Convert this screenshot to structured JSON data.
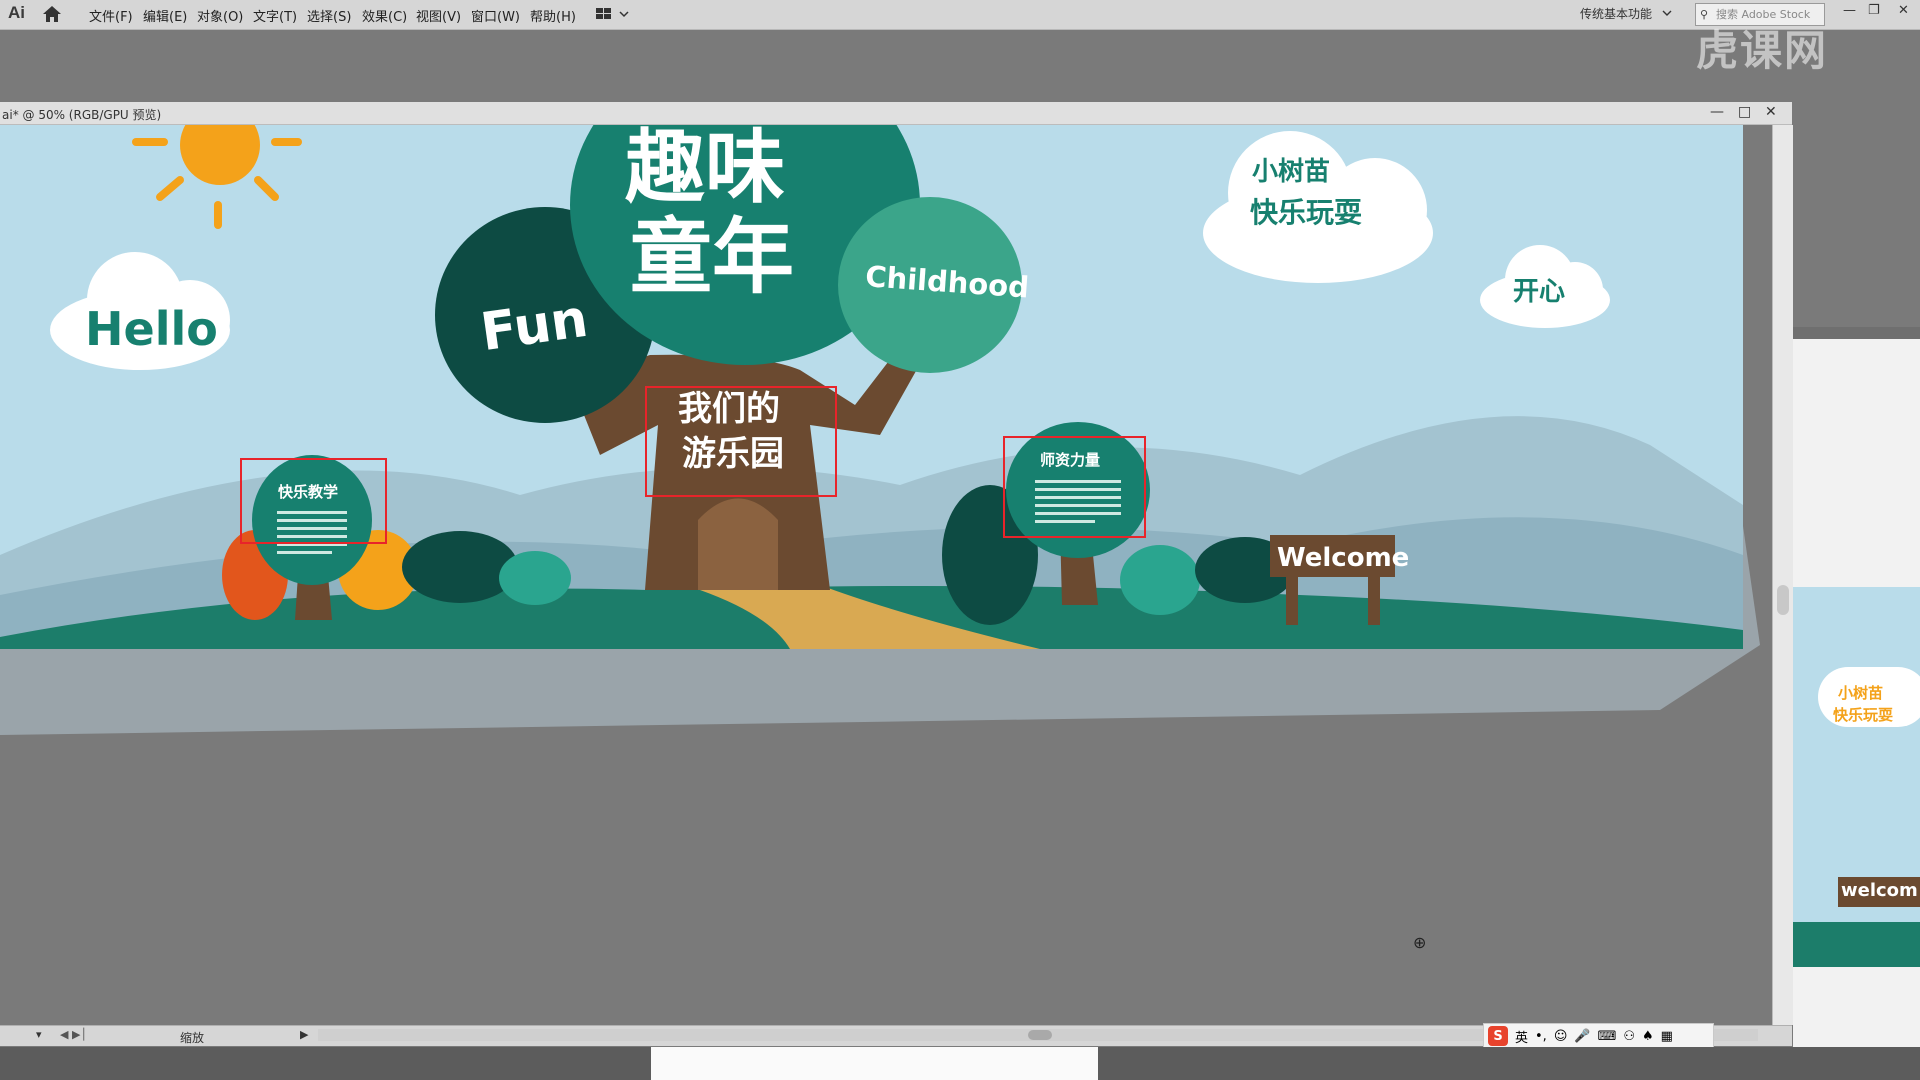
{
  "app": {
    "logo": "Ai",
    "menu": [
      "文件(F)",
      "编辑(E)",
      "对象(O)",
      "文字(T)",
      "选择(S)",
      "效果(C)",
      "视图(V)",
      "窗口(W)",
      "帮助(H)"
    ],
    "workspace": "传统基本功能",
    "search_placeholder": "搜索 Adobe Stock",
    "watermark": "虎课网"
  },
  "document": {
    "title": "ai* @ 50% (RGB/GPU 预览)",
    "status_zoom_label": "缩放"
  },
  "artwork": {
    "title_line1": "趣味",
    "title_line2": "童年",
    "tree_left_text": "Fun",
    "tree_right_text": "Childhood",
    "cloud_hello": "Hello",
    "cloud_top_line1": "小树苗",
    "cloud_top_line2": "快乐玩耍",
    "cloud_small": "开心",
    "trunk_text_line1": "我们的",
    "trunk_text_line2": "游乐园",
    "left_tree_title": "快乐教学",
    "right_tree_title": "师资力量",
    "sign_text": "Welcome",
    "right_panel_cloud_line1": "小树苗",
    "right_panel_cloud_line2": "快乐玩耍",
    "right_panel_sign": "welcom"
  },
  "ime": {
    "logo": "S",
    "mode": "英"
  },
  "colors": {
    "sky": "#b9dcea",
    "teal_dark": "#0d4b43",
    "teal": "#17806f",
    "teal_light": "#3ba58a",
    "trunk": "#6b4a30",
    "sun": "#f4a21a",
    "selection": "#e8242a"
  }
}
